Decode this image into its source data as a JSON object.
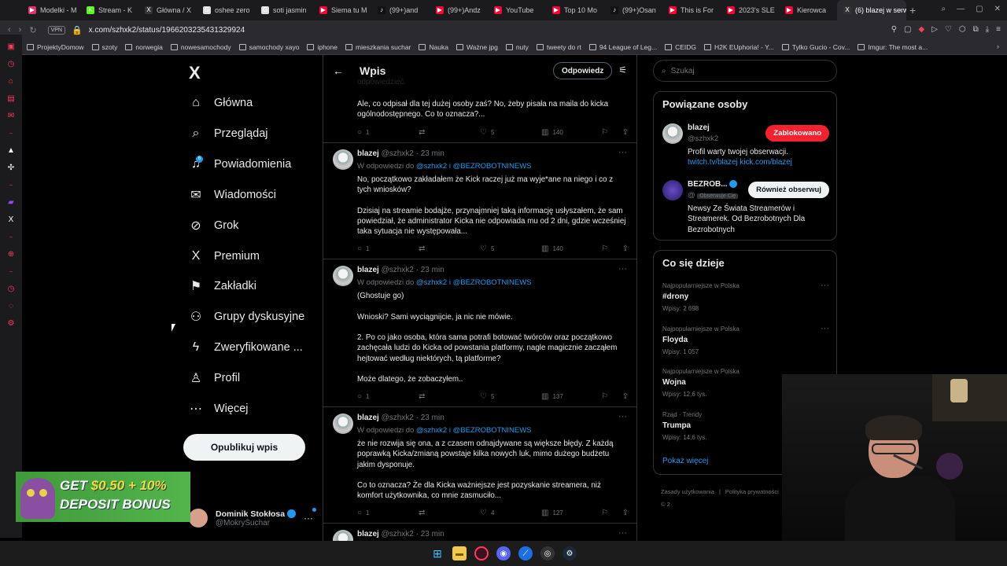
{
  "browser": {
    "tabs": [
      {
        "title": "Modelki - M",
        "color": "#e1306c",
        "glyph": "▶"
      },
      {
        "title": "Stream - K",
        "color": "#53fc18",
        "glyph": "K"
      },
      {
        "title": "Główna / X",
        "color": "#333333",
        "glyph": "X"
      },
      {
        "title": "oshee zero",
        "color": "#dddddd",
        "glyph": "G"
      },
      {
        "title": "soti jasmin",
        "color": "#dddddd",
        "glyph": "G"
      },
      {
        "title": "Siema tu M",
        "color": "#ff0033",
        "glyph": "▶"
      },
      {
        "title": "(99+)and",
        "color": "#111111",
        "glyph": "♪"
      },
      {
        "title": "(99+)Andz",
        "color": "#ff0033",
        "glyph": "▶"
      },
      {
        "title": "YouTube",
        "color": "#ff0033",
        "glyph": "▶"
      },
      {
        "title": "Top 10 Mo",
        "color": "#ff0033",
        "glyph": "▶"
      },
      {
        "title": "(99+)Osan",
        "color": "#111111",
        "glyph": "♪"
      },
      {
        "title": "This is For",
        "color": "#ff0033",
        "glyph": "▶"
      },
      {
        "title": "2023's SLE",
        "color": "#ff0033",
        "glyph": "▶"
      },
      {
        "title": "Kierowca",
        "color": "#ff0033",
        "glyph": "▶"
      },
      {
        "title": "(6) blazej w serwisie",
        "color": "#333333",
        "glyph": "X",
        "active": true
      }
    ],
    "vpn_label": "VPN",
    "url": "x.com/szhxk2/status/1966203235431329924",
    "bookmarks": [
      "ProjektyDomow",
      "szoty",
      "norwegia",
      "nowesamochody",
      "samochody xayo",
      "iphone",
      "mieszkania suchar",
      "Nauka",
      "Ważne jpg",
      "nuty",
      "tweety do rt",
      "94 League of Leg...",
      "CEIDG",
      "H2K EUphoria! - Y...",
      "Tylko Gucio - Cov...",
      "Imgur: The most a..."
    ]
  },
  "nav": {
    "logo": "X",
    "items": [
      {
        "label": "Główna",
        "icon": "home-icon",
        "glyph": "⌂"
      },
      {
        "label": "Przeglądaj",
        "icon": "search-icon",
        "glyph": "⌕"
      },
      {
        "label": "Powiadomienia",
        "icon": "bell-icon",
        "glyph": "♫",
        "badge": "6"
      },
      {
        "label": "Wiadomości",
        "icon": "mail-icon",
        "glyph": "✉"
      },
      {
        "label": "Grok",
        "icon": "grok-icon",
        "glyph": "⊘"
      },
      {
        "label": "Premium",
        "icon": "x-icon",
        "glyph": "X"
      },
      {
        "label": "Zakładki",
        "icon": "bookmark-icon",
        "glyph": "⚑"
      },
      {
        "label": "Grupy dyskusyjne",
        "icon": "people-icon",
        "glyph": "⚇"
      },
      {
        "label": "Zweryfikowane ...",
        "icon": "bolt-icon",
        "glyph": "ϟ"
      },
      {
        "label": "Profil",
        "icon": "person-icon",
        "glyph": "♙"
      },
      {
        "label": "Więcej",
        "icon": "more-icon",
        "glyph": "⋯"
      }
    ],
    "post_button": "Opublikuj wpis",
    "account": {
      "name": "Dominik Stokłosa",
      "handle": "@MokrySuchar"
    }
  },
  "feed": {
    "title": "Wpis",
    "reply_button": "Odpowiedz",
    "partial_top": "odpowiedzieć.",
    "first_block": {
      "lines": [
        "Ale, co odpisał dla tej dużej osoby zaś? No, żeby pisała na maila do kicka ogólnodostępnego. Co to oznacza?..."
      ],
      "replies": "1",
      "likes": "5",
      "views": "140"
    },
    "tweets": [
      {
        "name": "blazej",
        "handle": "@szhxk2",
        "time": "23 min",
        "reply_to_prefix": "W odpowiedzi do",
        "mentions": "@szhxk2 i @BEZROBOTNINEWS",
        "paragraphs": [
          "No, początkowo zakładałem że Kick raczej już ma wyje*ane na niego i co z tych wniosków?",
          "Dzisiaj na streamie bodajże, przynajmniej taką informację usłyszałem, że sam powiedział, że administrator Kicka nie odpowiada mu od 2 dni, gdzie wcześniej taka sytuacja nie występowała..."
        ],
        "replies": "1",
        "likes": "5",
        "views": "140"
      },
      {
        "name": "blazej",
        "handle": "@szhxk2",
        "time": "23 min",
        "reply_to_prefix": "W odpowiedzi do",
        "mentions": "@szhxk2 i @BEZROBOTNINEWS",
        "paragraphs": [
          "(Ghostuje go)",
          "Wnioski? Sami wyciągnijcie, ja nic nie mówie.",
          "2. Po co jako osoba, która sama potrafi botować twórców oraz początkowo zachęcała ludzi do Kicka od powstania platformy, nagle magicznie zacząłem hejtować według niektórych, tą platforme?",
          "Może dlatego, że zobaczyłem.."
        ],
        "replies": "1",
        "likes": "5",
        "views": "137"
      },
      {
        "name": "blazej",
        "handle": "@szhxk2",
        "time": "23 min",
        "reply_to_prefix": "W odpowiedzi do",
        "mentions": "@szhxk2 i @BEZROBOTNINEWS",
        "paragraphs": [
          "że nie rozwija się ona, a z czasem odnajdywane są większe błędy. Z każdą poprawką Kicka/zmianą powstaje kilka nowych luk, mimo dużego budżetu jakim dysponuje.",
          "Co to oznacza? Że dla Kicka ważniejsze jest pozyskanie streamera, niż komfort użytkownika, co mnie zasmuciło..."
        ],
        "replies": "1",
        "likes": "4",
        "views": "127"
      },
      {
        "name": "blazej",
        "handle": "@szhxk2",
        "time": "23 min"
      }
    ]
  },
  "right": {
    "search_placeholder": "Szukaj",
    "related": {
      "title": "Powiązane osoby",
      "people": [
        {
          "name": "blazej",
          "handle": "@szhxk2",
          "button": "Zablokowano",
          "bio": "Profil warty twojej obserwacji.",
          "links": "twitch.tv/blazej kick.com/blazej"
        },
        {
          "name": "BEZROB...",
          "handle": "@",
          "follows_you": "Obserwuje Cię",
          "button": "Również obserwuj",
          "bio": "Newsy Ze Świata Streamerów i Streamerek. Od Bezrobotnych Dla Bezrobotnych"
        }
      ]
    },
    "trends": {
      "title": "Co się dzieje",
      "items": [
        {
          "context": "Najpopularniejsze w Polska",
          "name": "#drony",
          "count": "Wpisy: 2 698"
        },
        {
          "context": "Najpopularniejsze w Polska",
          "name": "Floyda",
          "count": "Wpisy: 1 057"
        },
        {
          "context": "Najpopularniejsze w Polska",
          "name": "Wojna",
          "count": "Wpisy: 12,6 tys."
        },
        {
          "context": "Rząd · Trendy",
          "name": "Trumpa",
          "count": "Wpisy: 14,6 tys."
        }
      ],
      "show_more": "Pokaż więcej"
    },
    "footer": [
      "Zasady użytkowania",
      "Polityka prywatności",
      "Polityka dotycząca plików cookie",
      "Dostęp",
      "Informacje o reklamach",
      "Więcej ...",
      "© 2"
    ]
  },
  "ad": {
    "line1_a": "GET ",
    "line1_b": "$0.50 + 10%",
    "line2": "DEPOSIT BONUS"
  }
}
